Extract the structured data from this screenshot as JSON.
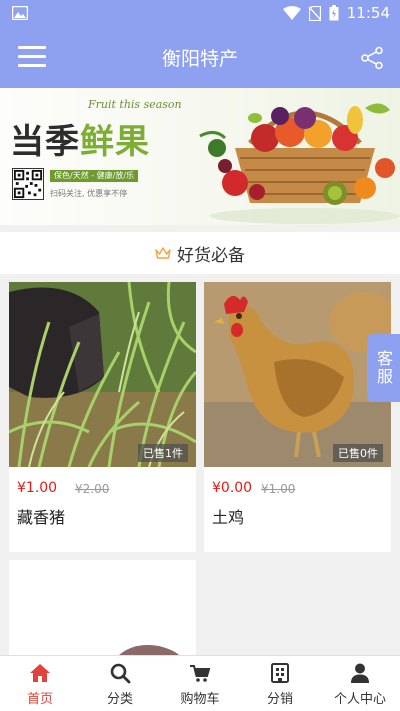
{
  "status_bar": {
    "time": "11:54"
  },
  "app_bar": {
    "title": "衡阳特产"
  },
  "banner": {
    "slogan_part1": "当季",
    "slogan_part2": "鲜果",
    "script": "Fruit this season",
    "tagline": "保色/天然 - 健康/放/乐",
    "subline": "扫码关注, 优惠享不停"
  },
  "section": {
    "title": "好货必备"
  },
  "products": [
    {
      "price": "¥1.00",
      "original_price": "¥2.00",
      "name": "藏香猪",
      "sold": "已售1件"
    },
    {
      "price": "¥0.00",
      "original_price": "¥1.00",
      "name": "土鸡",
      "sold": "已售0件"
    }
  ],
  "service_button": {
    "label": "客服"
  },
  "tabs": [
    {
      "label": "首页",
      "icon": "home-icon",
      "active": true
    },
    {
      "label": "分类",
      "icon": "search-icon",
      "active": false
    },
    {
      "label": "购物车",
      "icon": "cart-icon",
      "active": false
    },
    {
      "label": "分销",
      "icon": "distribution-icon",
      "active": false
    },
    {
      "label": "个人中心",
      "icon": "user-icon",
      "active": false
    }
  ],
  "colors": {
    "primary": "#8ea0f0",
    "price": "#e21a1a",
    "active_tab": "#e0433a",
    "background": "#f0f0f0"
  }
}
